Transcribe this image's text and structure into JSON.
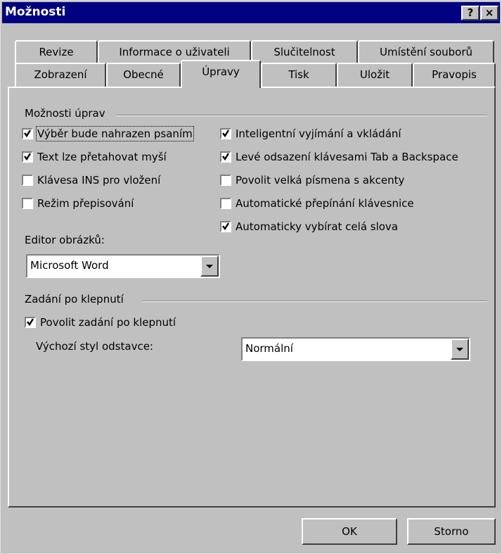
{
  "window": {
    "title": "Možnosti",
    "help_label": "?",
    "close_label": "×"
  },
  "tabs_back": [
    "Revize",
    "Informace o uživateli",
    "Slučitelnost",
    "Umístění souborů"
  ],
  "tabs_front": [
    "Zobrazení",
    "Obecné",
    "Úpravy",
    "Tisk",
    "Uložit",
    "Pravopis"
  ],
  "active_tab": "Úpravy",
  "edit_options": {
    "group_label": "Možnosti úprav",
    "left": [
      {
        "label": "Výběr bude nahrazen psaním",
        "checked": true
      },
      {
        "label": "Text lze přetahovat myší",
        "checked": true
      },
      {
        "label": "Klávesa INS pro vložení",
        "checked": false
      },
      {
        "label": "Režim přepisování",
        "checked": false
      }
    ],
    "right": [
      {
        "label": "Inteligentní vyjímání a vkládání",
        "checked": true
      },
      {
        "label": "Levé odsazení klávesami Tab a Backspace",
        "checked": true
      },
      {
        "label": "Povolit velká písmena s akcenty",
        "checked": false
      },
      {
        "label": "Automatické přepínání klávesnice",
        "checked": false
      },
      {
        "label": "Automaticky vybírat celá slova",
        "checked": true
      }
    ],
    "picture_editor_label": "Editor obrázků:",
    "picture_editor_value": "Microsoft Word"
  },
  "click_and_type": {
    "group_label": "Zadání po klepnutí",
    "enable_label": "Povolit zadání po klepnutí",
    "enable_checked": true,
    "default_style_label": "Výchozí styl odstavce:",
    "default_style_value": "Normální"
  },
  "buttons": {
    "ok": "OK",
    "cancel": "Storno"
  }
}
